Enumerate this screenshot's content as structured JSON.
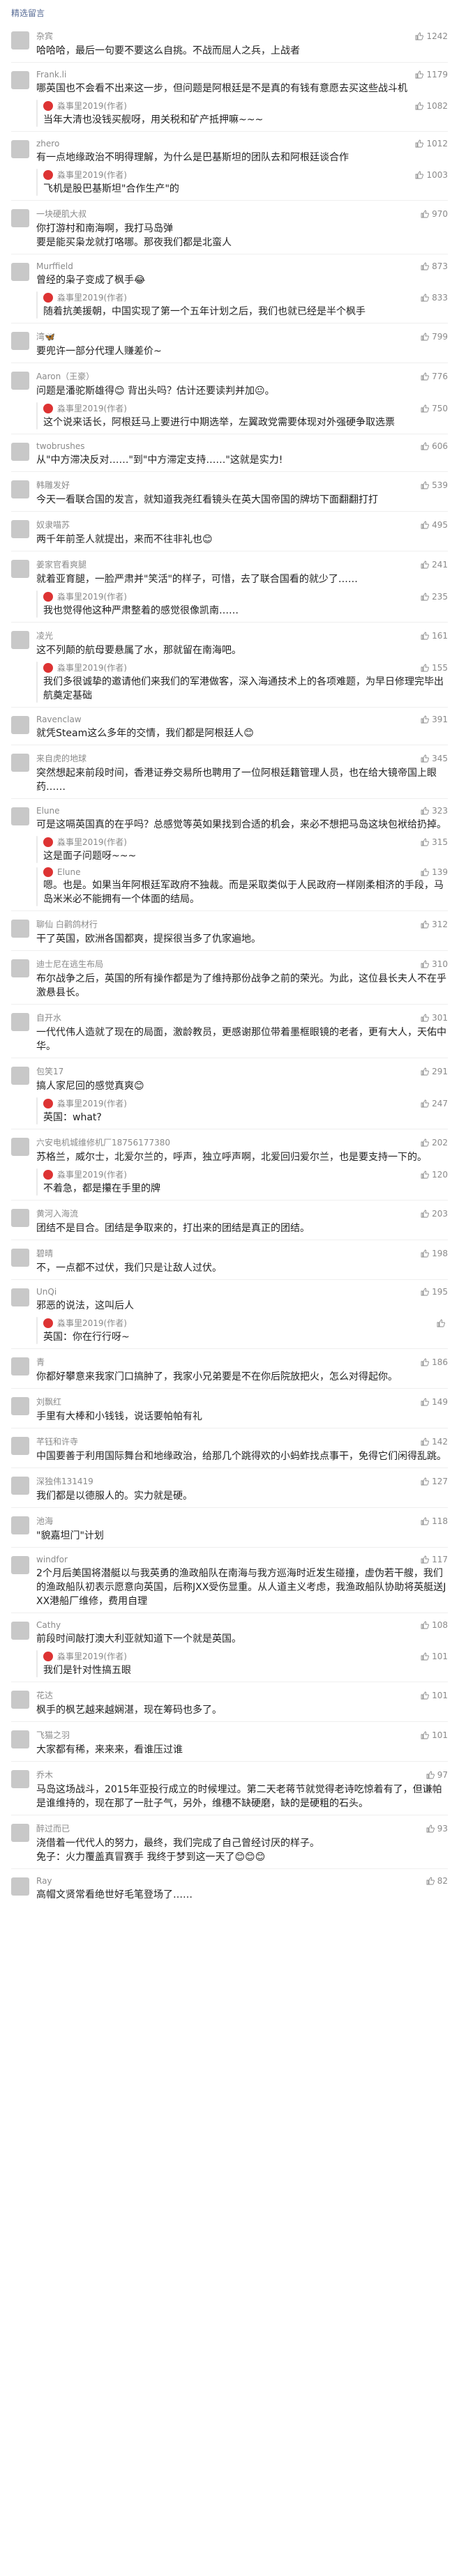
{
  "header": {
    "title": "精选留言"
  },
  "comments": [
    {
      "nickname": "杂宾",
      "likes": "1242",
      "text": "哈哈哈，最后一句要不要这么自挑。不战而屈人之兵，上战者"
    },
    {
      "nickname": "Frank.li",
      "likes": "1179",
      "text": "哪英国也不会看不出来这一步，但问题是阿根廷是不是真的有钱有意愿去买这些战斗机",
      "reply": {
        "author": "淼事里2019(作者)",
        "likes": "1082",
        "text": "当年大清也没钱买舰呀，用关税和矿产抵押嘛~~~"
      }
    },
    {
      "nickname": "zhero",
      "likes": "1012",
      "text": "有一点地缘政治不明得理解，为什么是巴基斯坦的团队去和阿根廷谈合作",
      "reply": {
        "author": "淼事里2019(作者)",
        "likes": "1003",
        "text": "飞机是股巴基斯坦\"合作生产\"的"
      }
    },
    {
      "nickname": "一块硬肌大叔",
      "likes": "970",
      "text": "你打游村和南海啊，我打马岛弹\n要是能买枭龙就打咯哪。那夜我们都是北蛮人"
    },
    {
      "nickname": "Murffield",
      "likes": "873",
      "text": "曾经的枭子变成了枫手😂",
      "reply": {
        "author": "淼事里2019(作者)",
        "likes": "833",
        "text": "随着抗美援朝，中国实现了第一个五年计划之后，我们也就已经是半个枫手"
      }
    },
    {
      "nickname": "湾🦋",
      "likes": "799",
      "text": "要兜许一部分代理人赚差价~"
    },
    {
      "nickname": "Aaron（王豪）",
      "likes": "776",
      "text": "问题是潘驼斯雄得😊 背出头吗？估计还要读判并加😐。",
      "reply": {
        "author": "淼事里2019(作者)",
        "likes": "750",
        "text": "这个说来话长，阿根廷马上要进行中期选举，左翼政党需要体现对外强硬争取选票"
      }
    },
    {
      "nickname": "twobrushes",
      "likes": "606",
      "text": "从\"中方滞决反对……\"到\"中方滞定支持……\"这就是实力!"
    },
    {
      "nickname": "韩雕发好",
      "likes": "539",
      "text": "今天一看联合国的发言，就知道我尧红看镜头在英大国帝国的牌坊下面翻翻打打"
    },
    {
      "nickname": "奴隶喵苏",
      "likes": "495",
      "text": "两千年前圣人就提出，来而不往非礼也😊"
    },
    {
      "nickname": "姜家官看爽腿",
      "likes": "241",
      "text": "就着亚育腿，一脸严肃并\"笑活\"的样子，可惜，去了联合国看的就少了……",
      "reply": {
        "author": "淼事里2019(作者)",
        "likes": "235",
        "text": "我也觉得他这种严肃整着的感觉很像凯南……"
      }
    },
    {
      "nickname": "凌光",
      "likes": "161",
      "text": "这不列颠的航母要悬属了水，那就留在南海吧。",
      "reply": {
        "author": "淼事里2019(作者)",
        "likes": "155",
        "text": "我们多很诚挚的邀请他们来我们的军港做客，深入海通技术上的各项难题，为早日修理完毕出航奠定基础"
      }
    },
    {
      "nickname": "Ravenclaw",
      "likes": "391",
      "text": "就凭Steam这么多年的交情，我们都是阿根廷人😊"
    },
    {
      "nickname": "来自虎的地球",
      "likes": "345",
      "text": "突然想起来前段时间，香港证券交易所也聘用了一位阿根廷籍管理人员，也在给大镜帝国上眼药……"
    },
    {
      "nickname": "Elune",
      "likes": "323",
      "text": "可是这嗝英国真的在乎吗？总感觉等英如果找到合适的机会，来必不想把马岛这块包袱给扔掉。",
      "reply": {
        "author": "淼事里2019(作者)",
        "likes": "315",
        "text": "这是面子问题呀~~~"
      },
      "reply2": {
        "author": "Elune",
        "likes": "139",
        "text": "嗯。也是。如果当年阿根廷军政府不独裁。而是采取类似于人民政府一样刚柔相济的手段，马岛米米必不能拥有一个体面的结局。"
      }
    },
    {
      "nickname": "聊仙 白鹳鸽材行",
      "likes": "312",
      "text": "干了英国，欧洲各国都爽，提探很当多了仇家遍地。"
    },
    {
      "nickname": "迪士尼在逃生布局",
      "likes": "310",
      "text": "布尔战争之后，英国的所有操作都是为了维持那份战争之前的荣光。为此，这位县长夫人不在乎激悬县长。"
    },
    {
      "nickname": "自开水",
      "likes": "301",
      "text": "一代代伟人造就了现在的局面，激龄教员，更感谢那位带着墨框眼镜的老者，更有大人，天佑中华。"
    },
    {
      "nickname": "包笑17",
      "likes": "291",
      "text": "搞人家尼回的感觉真爽😊",
      "reply": {
        "author": "淼事里2019(作者)",
        "likes": "247",
        "text": "英国：what?"
      }
    },
    {
      "nickname": "六安电机城维修机厂18756177380",
      "likes": "202",
      "text": "苏格兰，威尔士，北爱尔兰的，呼声，独立呼声啊，北爱回归爱尔兰，也是要支持一下的。",
      "reply": {
        "author": "淼事里2019(作者)",
        "likes": "120",
        "text": "不着急，都是攥在手里的牌"
      }
    },
    {
      "nickname": "黄河入海流",
      "likes": "203",
      "text": "团结不是目合。团结是争取来的，打出来的团结是真正的团结。"
    },
    {
      "nickname": "碧晴",
      "likes": "198",
      "text": "不，一点都不过伏，我们只是让敌人过伏。"
    },
    {
      "nickname": "UnQi",
      "likes": "195",
      "text": "邪恶的说法，这叫后人",
      "reply": {
        "author": "淼事里2019(作者)",
        "likes": "",
        "text": "英国：你在行行呀~"
      }
    },
    {
      "nickname": "青",
      "likes": "186",
      "text": "你都好攀意来我家门口搞肿了，我家小兄弟要是不在你后院放把火，怎么对得起你。"
    },
    {
      "nickname": "刘飘红",
      "likes": "149",
      "text": "手里有大棒和小钱钱，说话要帕帕有礼"
    },
    {
      "nickname": "芊钰和许寺",
      "likes": "142",
      "text": "中国要善于利用国际舞台和地缘政治，给那几个跳得欢的小蚂蚱找点事干，免得它们闲得乱跳。"
    },
    {
      "nickname": "深独伟131419",
      "likes": "127",
      "text": "我们都是以德服人的。实力就是硬。"
    },
    {
      "nickname": "池海",
      "likes": "118",
      "text": "\"貌嘉坦门\"计划"
    },
    {
      "nickname": "windfor",
      "likes": "117",
      "text": "2个月后美国将潜艇以与我英勇的渔政船队在南海与我方巡海时近发生碰撞，虚伪若干艘，我们的渔政船队初表示愿意向英国，后称JXX受伤显重。从人道主义考虑，我渔政船队协助将英艇送JXX港船厂维修，费用自理"
    },
    {
      "nickname": "Cathy",
      "likes": "108",
      "text": "前段时间敲打澳大利亚就知道下一个就是英国。",
      "reply": {
        "author": "淼事里2019(作者)",
        "likes": "101",
        "text": "我们是针对性搞五眼"
      }
    },
    {
      "nickname": "花达",
      "likes": "101",
      "text": "枫手的枫艺越来越娴湛，现在筹码也多了。"
    },
    {
      "nickname": "飞猫之羽",
      "likes": "101",
      "text": "大家都有稀，来来来，看谁压过谁"
    },
    {
      "nickname": "乔木",
      "likes": "97",
      "text": "马岛这场战斗，2015年亚投行成立的时候埋过。第二天老蒋节就觉得老诗吃惊着有了，但谦帕是谁维持的，现在那了一肚子气，另外，维穗不缺硬磨，缺的是硬粗的石头。"
    },
    {
      "nickname": "醉过而已",
      "likes": "93",
      "text": "浇借着一代代人的努力，最终，我们完成了自己曾经讨厌的样子。\n免子：火力覆盖真冒赛手 我终于梦到这一天了😊😊😊"
    },
    {
      "nickname": "Ray",
      "likes": "82",
      "text": "高帽文贤常看绝世好毛笔登场了……"
    }
  ]
}
